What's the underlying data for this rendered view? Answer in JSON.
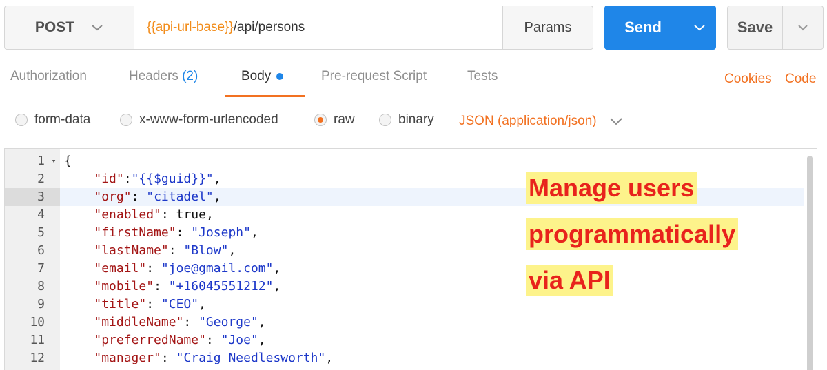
{
  "request": {
    "method": "POST",
    "url_variable": "{{api-url-base}}",
    "url_path": "/api/persons",
    "params_label": "Params",
    "send_label": "Send",
    "save_label": "Save"
  },
  "tabs": [
    {
      "label": "Authorization"
    },
    {
      "label": "Headers",
      "count": "(2)"
    },
    {
      "label": "Body",
      "active": true
    },
    {
      "label": "Pre-request Script"
    },
    {
      "label": "Tests"
    }
  ],
  "links": {
    "cookies": "Cookies",
    "code": "Code"
  },
  "body_options": [
    {
      "label": "form-data",
      "checked": false
    },
    {
      "label": "x-www-form-urlencoded",
      "checked": false
    },
    {
      "label": "raw",
      "checked": true
    },
    {
      "label": "binary",
      "checked": false
    }
  ],
  "content_type": "JSON (application/json)",
  "editor": {
    "active_line": 3,
    "lines": [
      {
        "num": "1",
        "text": "{"
      },
      {
        "num": "2",
        "key": "\"id\"",
        "sep": ":",
        "value": "\"{{$guid}}\"",
        "tail": ","
      },
      {
        "num": "3",
        "key": "\"org\"",
        "sep": ": ",
        "value": "\"citadel\"",
        "tail": ","
      },
      {
        "num": "4",
        "key": "\"enabled\"",
        "sep": ": ",
        "value": "true",
        "tail": ","
      },
      {
        "num": "5",
        "key": "\"firstName\"",
        "sep": ": ",
        "value": "\"Joseph\"",
        "tail": ","
      },
      {
        "num": "6",
        "key": "\"lastName\"",
        "sep": ": ",
        "value": "\"Blow\"",
        "tail": ","
      },
      {
        "num": "7",
        "key": "\"email\"",
        "sep": ": ",
        "value": "\"joe@gmail.com\"",
        "tail": ","
      },
      {
        "num": "8",
        "key": "\"mobile\"",
        "sep": ": ",
        "value": "\"+16045551212\"",
        "tail": ","
      },
      {
        "num": "9",
        "key": "\"title\"",
        "sep": ": ",
        "value": "\"CEO\"",
        "tail": ","
      },
      {
        "num": "10",
        "key": "\"middleName\"",
        "sep": ": ",
        "value": "\"George\"",
        "tail": ","
      },
      {
        "num": "11",
        "key": "\"preferredName\"",
        "sep": ": ",
        "value": "\"Joe\"",
        "tail": ","
      },
      {
        "num": "12",
        "key": "\"manager\"",
        "sep": ": ",
        "value": "\"Craig Needlesworth\"",
        "tail": ","
      }
    ]
  },
  "annotation": [
    "Manage users",
    "programmatically",
    "via API"
  ],
  "colors": {
    "accent": "#f27121",
    "send": "#1f86e8",
    "annotation_text": "#e8231c",
    "annotation_bg": "#fdf38b"
  }
}
